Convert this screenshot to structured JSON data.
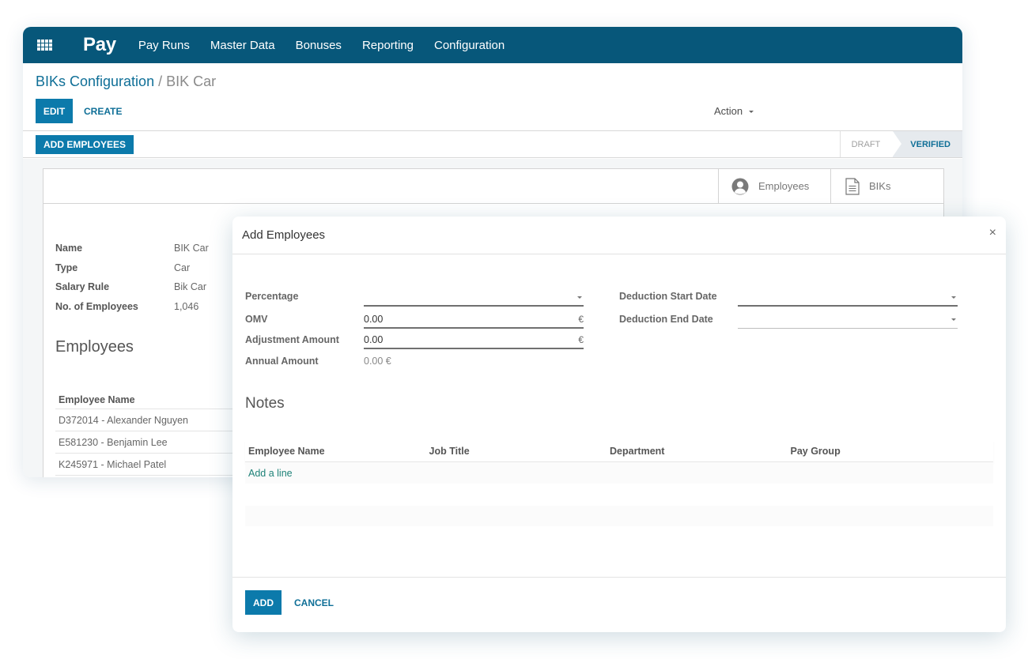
{
  "navbar": {
    "app_title": "Pay",
    "menu": [
      "Pay Runs",
      "Master Data",
      "Bonuses",
      "Reporting",
      "Configuration"
    ],
    "brand_color": "#07577a"
  },
  "control_panel": {
    "breadcrumb_parent": "BIKs Configuration",
    "breadcrumb_separator": "/",
    "breadcrumb_current": "BIK Car",
    "edit_label": "EDIT",
    "create_label": "CREATE",
    "action_label": "Action"
  },
  "statusbar": {
    "add_employees_label": "ADD EMPLOYEES",
    "steps": [
      {
        "label": "DRAFT",
        "active": false
      },
      {
        "label": "VERIFIED",
        "active": true
      }
    ]
  },
  "sheet": {
    "stat_buttons": [
      {
        "icon": "user-circle-icon",
        "label": "Employees"
      },
      {
        "icon": "document-icon",
        "label": "BIKs"
      }
    ],
    "fields": [
      {
        "label": "Name",
        "value": "BIK Car"
      },
      {
        "label": "Type",
        "value": "Car"
      },
      {
        "label": "Salary Rule",
        "value": "Bik Car"
      },
      {
        "label": "No. of Employees",
        "value": "1,046"
      }
    ],
    "section_title": "Employees",
    "employee_table": {
      "header": "Employee Name",
      "rows": [
        "D372014 - Alexander Nguyen",
        "E581230 - Benjamin Lee",
        "K245971 - Michael Patel"
      ]
    }
  },
  "modal": {
    "title": "Add Employees",
    "close_icon": "×",
    "left_fields": {
      "percentage_label": "Percentage",
      "percentage_value": "",
      "omv_label": "OMV",
      "omv_value": "0.00",
      "adjustment_label": "Adjustment Amount",
      "adjustment_value": "0.00",
      "annual_label": "Annual Amount",
      "annual_value": "0.00 €",
      "currency_symbol": "€"
    },
    "right_fields": {
      "start_label": "Deduction Start Date",
      "start_value": "",
      "end_label": "Deduction End Date",
      "end_value": ""
    },
    "notes_title": "Notes",
    "lines_table": {
      "columns": [
        "Employee Name",
        "Job Title",
        "Department",
        "Pay Group"
      ],
      "add_line_label": "Add a line"
    },
    "add_label": "ADD",
    "cancel_label": "CANCEL"
  }
}
